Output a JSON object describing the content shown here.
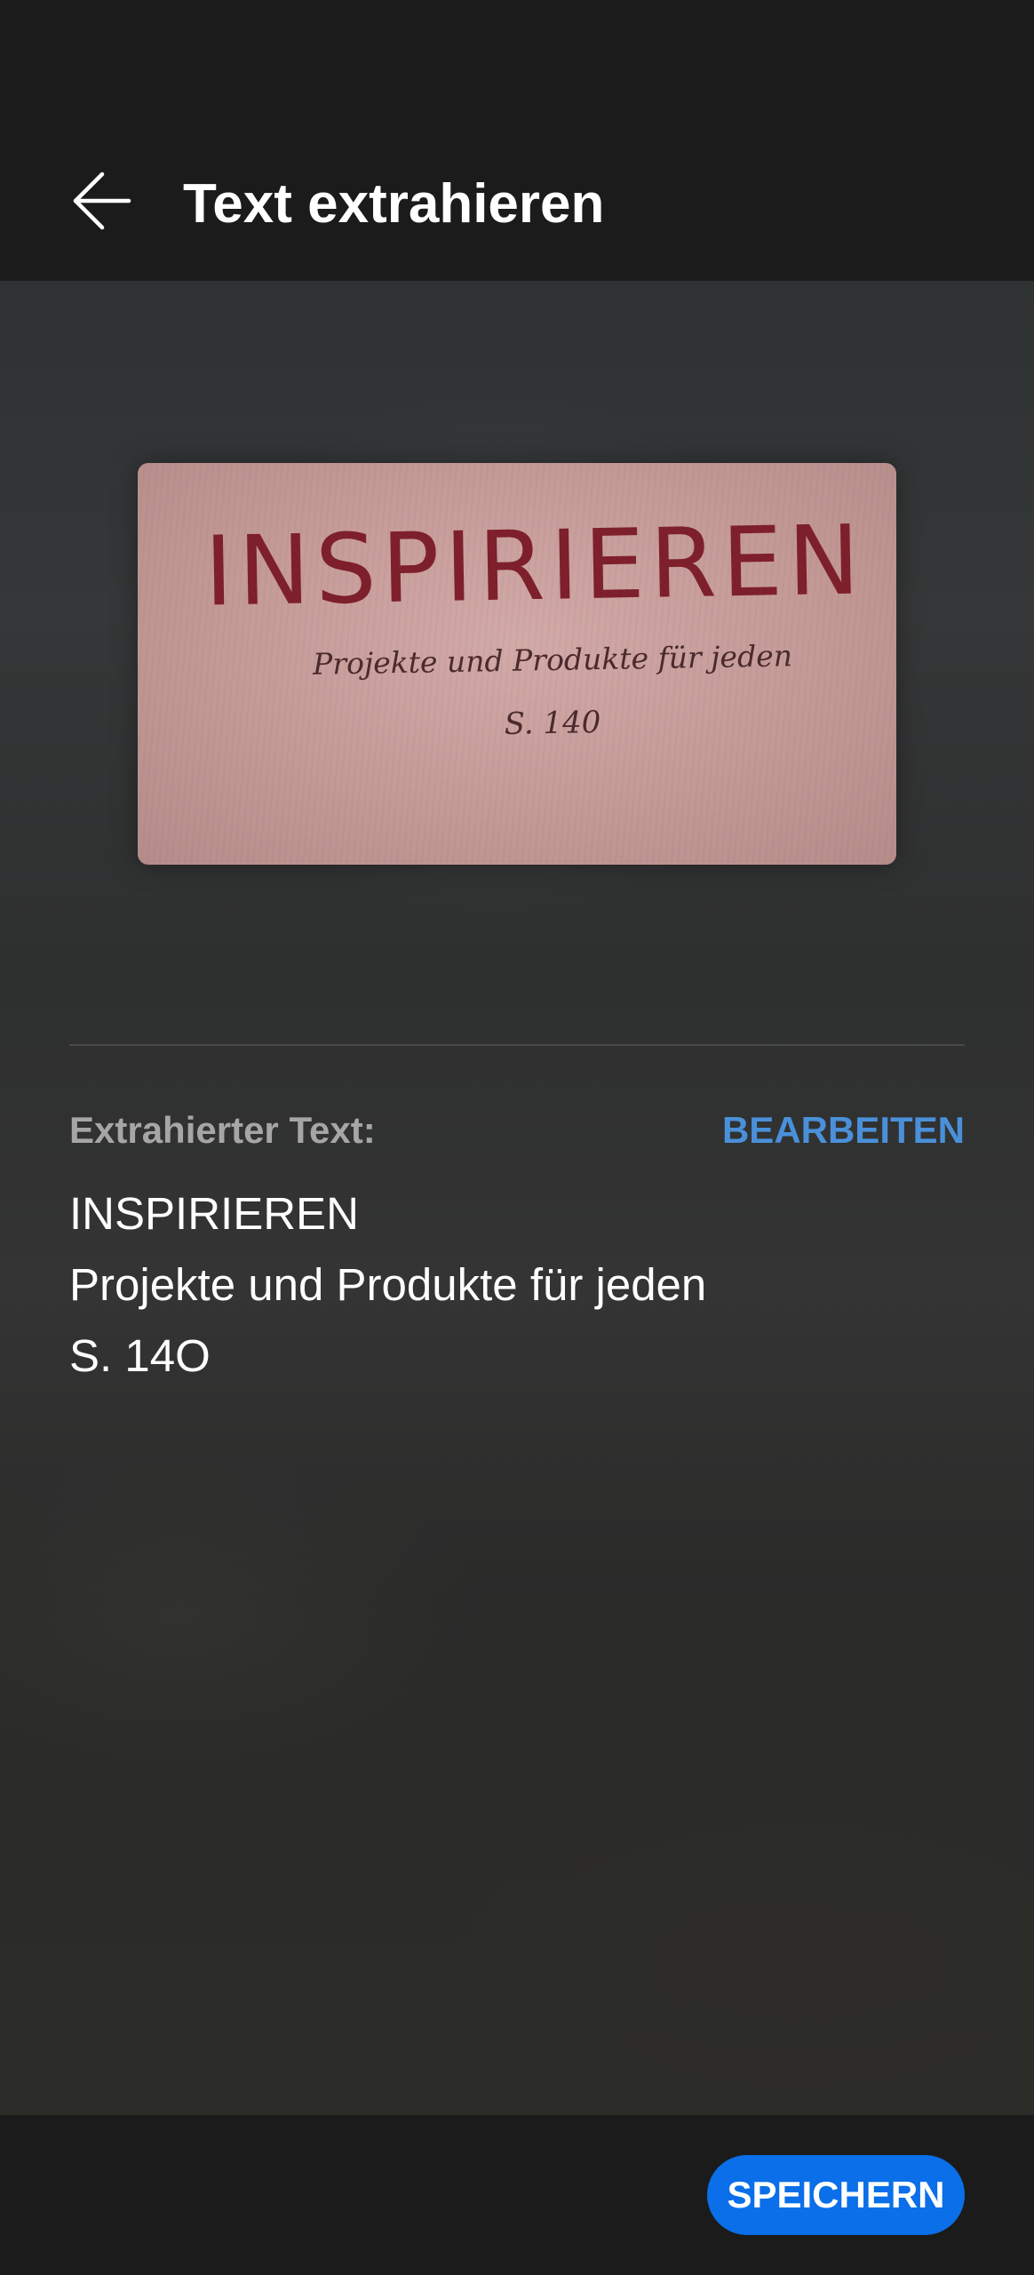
{
  "header": {
    "back_icon": "arrow-left-icon",
    "title": "Text extrahieren"
  },
  "preview": {
    "heading": "INSPIRIEREN",
    "subtitle": "Projekte und Produkte für jeden",
    "page": "S. 140"
  },
  "result": {
    "label": "Extrahierter Text:",
    "edit_label": "BEARBEITEN",
    "lines": [
      "INSPIRIEREN",
      "Projekte und Produkte für jeden",
      "S. 14O"
    ]
  },
  "footer": {
    "save_label": "SPEICHERN"
  },
  "colors": {
    "background": "#1b1b1b",
    "accent_link": "#4a90d9",
    "primary_button": "#0a6fe8",
    "label_text": "#a6a6a6",
    "photo_heading": "#7e1f2c"
  }
}
